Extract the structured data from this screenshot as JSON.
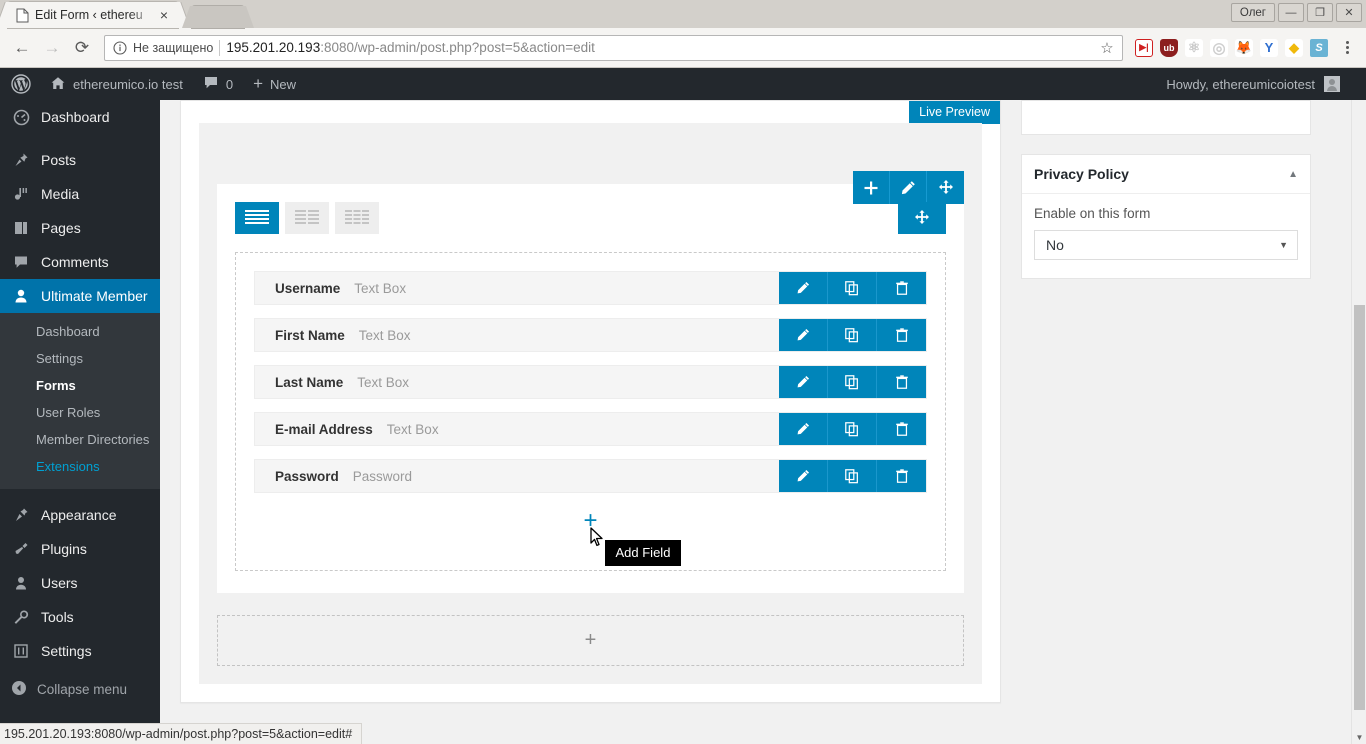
{
  "browser": {
    "tab": {
      "title": "Edit Form ‹ ethereu",
      "favicon_icon": "page-icon",
      "close_icon": "×"
    },
    "window": {
      "user_label": "Олег",
      "minimize": "—",
      "maximize": "❐",
      "close": "✕"
    },
    "toolbar": {
      "back_icon": "←",
      "forward_icon": "→",
      "reload_icon": "⟳",
      "security_icon": "info-circle-icon",
      "security_text": "Не защищено",
      "url_host": "195.201.20.193",
      "url_rest": ":8080/wp-admin/post.php?post=5&action=edit",
      "bookmark_icon": "☆",
      "menu_icon": "kebab-menu-icon",
      "extensions": [
        {
          "name": "video-downloader-extension",
          "glyph": "▶|",
          "color": "#cf2020",
          "bg": "#ffffff"
        },
        {
          "name": "ublock-origin-extension",
          "glyph": "ub",
          "color": "#ffffff",
          "bg": "#8c1e1e"
        },
        {
          "name": "react-devtools-extension",
          "glyph": "⚛",
          "color": "#cccccc",
          "bg": "#ffffff"
        },
        {
          "name": "target-extension",
          "glyph": "◎",
          "color": "#cfcfcf",
          "bg": "#ffffff"
        },
        {
          "name": "metamask-extension",
          "glyph": "🦊",
          "color": "#e2761b",
          "bg": "#ffffff"
        },
        {
          "name": "yandex-extension",
          "glyph": "Y",
          "color": "#2f6fd0",
          "bg": "#ffffff"
        },
        {
          "name": "binance-extension",
          "glyph": "◆",
          "color": "#f0b90b",
          "bg": "#ffffff"
        },
        {
          "name": "s-extension",
          "glyph": "S",
          "color": "#ffffff",
          "bg": "#6ab3d4"
        }
      ]
    },
    "statusbar_url": "195.201.20.193:8080/wp-admin/post.php?post=5&action=edit#"
  },
  "adminbar": {
    "logo_icon": "wordpress-icon",
    "home_icon": "home-icon",
    "site_name": "ethereumico.io test",
    "comments_icon": "comment-icon",
    "comments_count": "0",
    "new_icon": "+",
    "new_label": "New",
    "howdy": "Howdy, ethereumicoiotest",
    "avatar_icon": "avatar-icon"
  },
  "sidebar": {
    "items": [
      {
        "label": "Dashboard",
        "icon": "dashboard-icon",
        "glyph": "◉"
      },
      {
        "label": "Posts",
        "icon": "pin-icon",
        "glyph": "✎"
      },
      {
        "label": "Media",
        "icon": "media-icon",
        "glyph": "♫"
      },
      {
        "label": "Pages",
        "icon": "pages-icon",
        "glyph": "▤"
      },
      {
        "label": "Comments",
        "icon": "comment-icon",
        "glyph": "▬"
      },
      {
        "label": "Ultimate Member",
        "icon": "user-icon",
        "glyph": "●",
        "active": true
      }
    ],
    "submenu": [
      {
        "label": "Dashboard",
        "state": "normal"
      },
      {
        "label": "Settings",
        "state": "normal"
      },
      {
        "label": "Forms",
        "state": "current"
      },
      {
        "label": "User Roles",
        "state": "normal"
      },
      {
        "label": "Member Directories",
        "state": "normal"
      },
      {
        "label": "Extensions",
        "state": "hilite"
      }
    ],
    "items2": [
      {
        "label": "Appearance",
        "icon": "brush-icon",
        "glyph": "✎"
      },
      {
        "label": "Plugins",
        "icon": "plug-icon",
        "glyph": "⚯"
      },
      {
        "label": "Users",
        "icon": "users-icon",
        "glyph": "●"
      },
      {
        "label": "Tools",
        "icon": "wrench-icon",
        "glyph": "⚒"
      },
      {
        "label": "Settings",
        "icon": "sliders-icon",
        "glyph": "⇅"
      }
    ],
    "collapse": {
      "label": "Collapse menu",
      "icon": "collapse-arrow-icon",
      "glyph": "◀"
    }
  },
  "builder": {
    "live_preview_label": "Live Preview",
    "row_actions": [
      {
        "name": "add-row-button",
        "icon": "plus-icon"
      },
      {
        "name": "edit-row-button",
        "icon": "pencil-icon"
      },
      {
        "name": "move-row-button",
        "icon": "move-arrows-icon"
      }
    ],
    "column_layouts": [
      {
        "name": "layout-1-column",
        "cols": 1,
        "selected": true
      },
      {
        "name": "layout-2-columns",
        "cols": 2,
        "selected": false
      },
      {
        "name": "layout-3-columns",
        "cols": 3,
        "selected": false
      }
    ],
    "column_move_icon": "move-arrows-icon",
    "fields": [
      {
        "label": "Username",
        "type": "Text Box"
      },
      {
        "label": "First Name",
        "type": "Text Box"
      },
      {
        "label": "Last Name",
        "type": "Text Box"
      },
      {
        "label": "E-mail Address",
        "type": "Text Box"
      },
      {
        "label": "Password",
        "type": "Password"
      }
    ],
    "field_actions": [
      {
        "name": "edit-field-button",
        "icon": "pencil-icon"
      },
      {
        "name": "duplicate-field-button",
        "icon": "copy-icon"
      },
      {
        "name": "delete-field-button",
        "icon": "trash-icon"
      }
    ],
    "add_field": {
      "plus": "+",
      "tooltip": "Add Field"
    },
    "add_row": {
      "plus": "+"
    }
  },
  "privacy_panel": {
    "title": "Privacy Policy",
    "toggle_icon": "chevron-up-icon",
    "label": "Enable on this form",
    "select_value": "No",
    "select_caret": "▼"
  },
  "colors": {
    "accent": "#0085ba",
    "adminbar": "#23282d",
    "submenu_bg": "#32373c",
    "link": "#00a0d2",
    "page_bg": "#f1f1f1"
  }
}
